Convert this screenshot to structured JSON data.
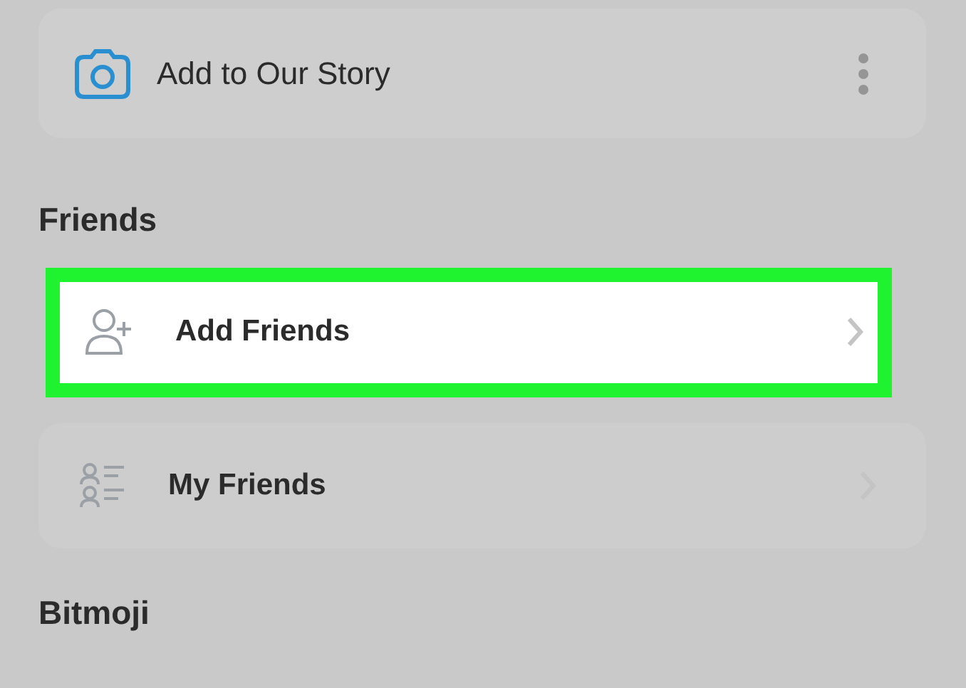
{
  "top_item": {
    "label": "Add to Our Story",
    "kind": "camera"
  },
  "sections": [
    {
      "title": "Friends",
      "items": [
        {
          "label": "Add Friends",
          "kind": "add-friend",
          "selected": true
        },
        {
          "label": "My Friends",
          "kind": "friends-list",
          "selected": false
        }
      ]
    },
    {
      "title": "Bitmoji"
    }
  ]
}
